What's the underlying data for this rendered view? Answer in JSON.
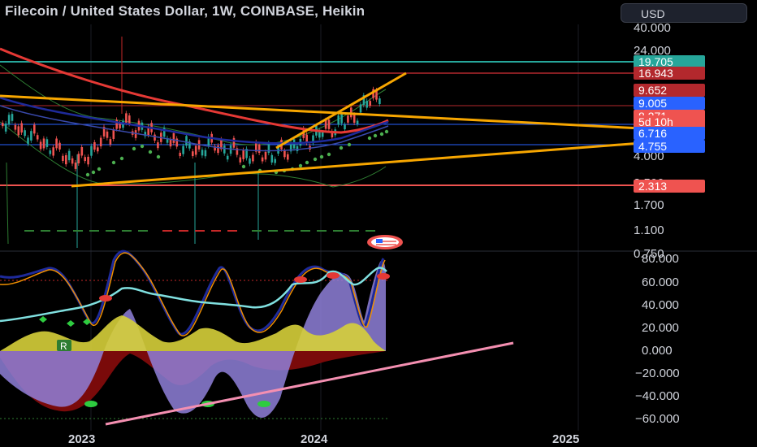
{
  "header": {
    "title": "Filecoin / United States Dollar, 1W, COINBASE, Heikin",
    "currency": "USD"
  },
  "colors": {
    "background": "#000000",
    "up": "#26a69a",
    "down": "#ef5350",
    "trendline": "#f7a600",
    "ma_red": "#e53935",
    "oscillator_fill": "#8f80d9",
    "yellow_fill": "#d6cf3a",
    "dark_red_fill": "#7a0a0a"
  },
  "price_axis": {
    "ticks": [
      "40.000",
      "24.000",
      "4.000",
      "2.500",
      "1.700",
      "1.100",
      "0.750"
    ]
  },
  "price_badges": [
    {
      "value": "19.705",
      "color": "#26a69a"
    },
    {
      "value": "16.943",
      "color": "#b3282d"
    },
    {
      "value": "9.652",
      "color": "#b3282d"
    },
    {
      "value": "9.005",
      "color": "#2962ff"
    },
    {
      "value": "8.271",
      "color": "#ef5350"
    },
    {
      "value": "5d 10h",
      "color": "#ef5350"
    },
    {
      "value": "6.716",
      "color": "#2962ff"
    },
    {
      "value": "4.755",
      "color": "#2962ff"
    },
    {
      "value": "2.313",
      "color": "#ef5350"
    }
  ],
  "oscillator_axis": {
    "ticks": [
      "80.000",
      "60.000",
      "40.000",
      "20.000",
      "0.000",
      "−20.000",
      "−40.000",
      "−60.000"
    ]
  },
  "time_axis": {
    "labels": [
      "2023",
      "2024",
      "2025"
    ]
  },
  "markers": {
    "r_label": "R"
  },
  "icons": {
    "flag": "us-flag-icon"
  }
}
